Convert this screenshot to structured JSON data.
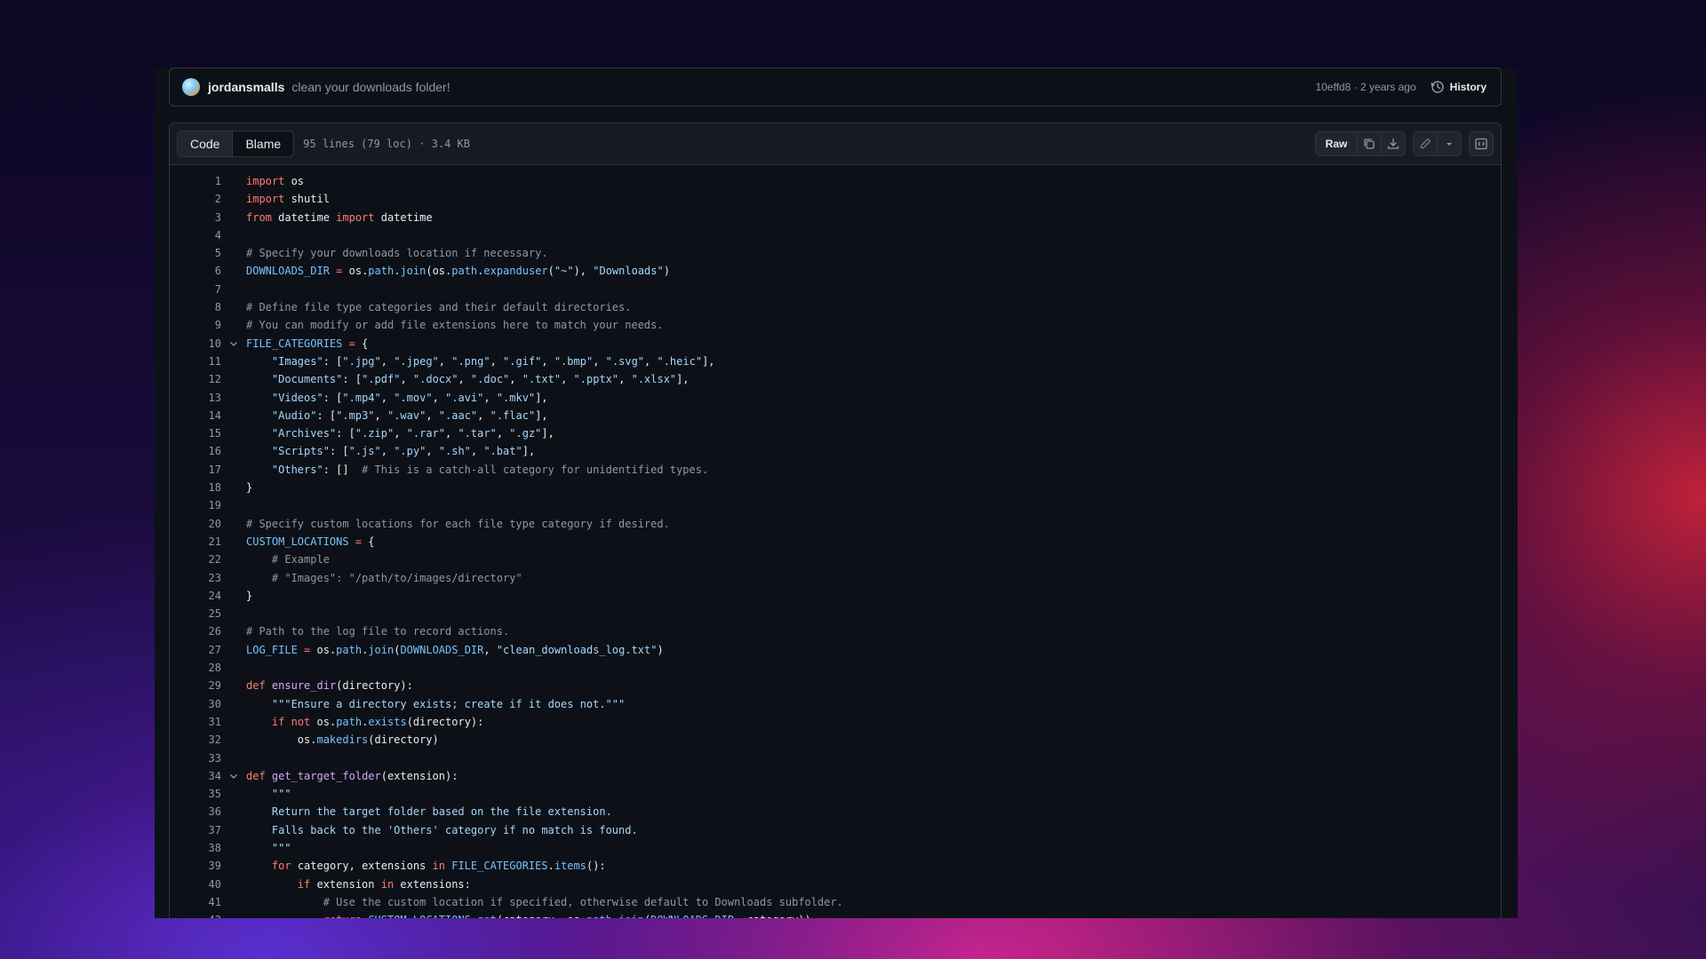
{
  "commit": {
    "author": "jordansmalls",
    "message": "clean your downloads folder!",
    "meta": "10effd8 · 2 years ago",
    "history_label": "History"
  },
  "toolbar": {
    "tabs": [
      "Code",
      "Blame"
    ],
    "active_tab": "Code",
    "file_info": "95 lines (79 loc) · 3.4 KB",
    "raw_label": "Raw",
    "icons": [
      "copy-icon",
      "download-icon",
      "pencil-icon",
      "chevron-down-icon",
      "symbols-icon"
    ]
  },
  "code": {
    "foldable_lines": [
      10,
      34
    ],
    "lines": [
      [
        [
          "k",
          "import"
        ],
        [
          "n",
          " os"
        ]
      ],
      [
        [
          "k",
          "import"
        ],
        [
          "n",
          " shutil"
        ]
      ],
      [
        [
          "k",
          "from"
        ],
        [
          "n",
          " datetime "
        ],
        [
          "k",
          "import"
        ],
        [
          "n",
          " datetime"
        ]
      ],
      [],
      [
        [
          "c",
          "# Specify your downloads location if necessary."
        ]
      ],
      [
        [
          "v",
          "DOWNLOADS_DIR"
        ],
        [
          "n",
          " "
        ],
        [
          "k2",
          "="
        ],
        [
          "n",
          " os."
        ],
        [
          "a",
          "path"
        ],
        [
          "n",
          "."
        ],
        [
          "a",
          "join"
        ],
        [
          "n",
          "(os."
        ],
        [
          "a",
          "path"
        ],
        [
          "n",
          "."
        ],
        [
          "a",
          "expanduser"
        ],
        [
          "n",
          "("
        ],
        [
          "s",
          "\"~\""
        ],
        [
          "n",
          "), "
        ],
        [
          "s",
          "\"Downloads\""
        ],
        [
          "n",
          ")"
        ]
      ],
      [],
      [
        [
          "c",
          "# Define file type categories and their default directories."
        ]
      ],
      [
        [
          "c",
          "# You can modify or add file extensions here to match your needs."
        ]
      ],
      [
        [
          "v",
          "FILE_CATEGORIES"
        ],
        [
          "n",
          " "
        ],
        [
          "k2",
          "="
        ],
        [
          "n",
          " {"
        ]
      ],
      [
        [
          "n",
          "    "
        ],
        [
          "s",
          "\"Images\""
        ],
        [
          "n",
          ": ["
        ],
        [
          "s",
          "\".jpg\""
        ],
        [
          "n",
          ", "
        ],
        [
          "s",
          "\".jpeg\""
        ],
        [
          "n",
          ", "
        ],
        [
          "s",
          "\".png\""
        ],
        [
          "n",
          ", "
        ],
        [
          "s",
          "\".gif\""
        ],
        [
          "n",
          ", "
        ],
        [
          "s",
          "\".bmp\""
        ],
        [
          "n",
          ", "
        ],
        [
          "s",
          "\".svg\""
        ],
        [
          "n",
          ", "
        ],
        [
          "s",
          "\".heic\""
        ],
        [
          "n",
          "],"
        ]
      ],
      [
        [
          "n",
          "    "
        ],
        [
          "s",
          "\"Documents\""
        ],
        [
          "n",
          ": ["
        ],
        [
          "s",
          "\".pdf\""
        ],
        [
          "n",
          ", "
        ],
        [
          "s",
          "\".docx\""
        ],
        [
          "n",
          ", "
        ],
        [
          "s",
          "\".doc\""
        ],
        [
          "n",
          ", "
        ],
        [
          "s",
          "\".txt\""
        ],
        [
          "n",
          ", "
        ],
        [
          "s",
          "\".pptx\""
        ],
        [
          "n",
          ", "
        ],
        [
          "s",
          "\".xlsx\""
        ],
        [
          "n",
          "],"
        ]
      ],
      [
        [
          "n",
          "    "
        ],
        [
          "s",
          "\"Videos\""
        ],
        [
          "n",
          ": ["
        ],
        [
          "s",
          "\".mp4\""
        ],
        [
          "n",
          ", "
        ],
        [
          "s",
          "\".mov\""
        ],
        [
          "n",
          ", "
        ],
        [
          "s",
          "\".avi\""
        ],
        [
          "n",
          ", "
        ],
        [
          "s",
          "\".mkv\""
        ],
        [
          "n",
          "],"
        ]
      ],
      [
        [
          "n",
          "    "
        ],
        [
          "s",
          "\"Audio\""
        ],
        [
          "n",
          ": ["
        ],
        [
          "s",
          "\".mp3\""
        ],
        [
          "n",
          ", "
        ],
        [
          "s",
          "\".wav\""
        ],
        [
          "n",
          ", "
        ],
        [
          "s",
          "\".aac\""
        ],
        [
          "n",
          ", "
        ],
        [
          "s",
          "\".flac\""
        ],
        [
          "n",
          "],"
        ]
      ],
      [
        [
          "n",
          "    "
        ],
        [
          "s",
          "\"Archives\""
        ],
        [
          "n",
          ": ["
        ],
        [
          "s",
          "\".zip\""
        ],
        [
          "n",
          ", "
        ],
        [
          "s",
          "\".rar\""
        ],
        [
          "n",
          ", "
        ],
        [
          "s",
          "\".tar\""
        ],
        [
          "n",
          ", "
        ],
        [
          "s",
          "\".gz\""
        ],
        [
          "n",
          "],"
        ]
      ],
      [
        [
          "n",
          "    "
        ],
        [
          "s",
          "\"Scripts\""
        ],
        [
          "n",
          ": ["
        ],
        [
          "s",
          "\".js\""
        ],
        [
          "n",
          ", "
        ],
        [
          "s",
          "\".py\""
        ],
        [
          "n",
          ", "
        ],
        [
          "s",
          "\".sh\""
        ],
        [
          "n",
          ", "
        ],
        [
          "s",
          "\".bat\""
        ],
        [
          "n",
          "],"
        ]
      ],
      [
        [
          "n",
          "    "
        ],
        [
          "s",
          "\"Others\""
        ],
        [
          "n",
          ": []  "
        ],
        [
          "c",
          "# This is a catch-all category for unidentified types."
        ]
      ],
      [
        [
          "n",
          "}"
        ]
      ],
      [],
      [
        [
          "c",
          "# Specify custom locations for each file type category if desired."
        ]
      ],
      [
        [
          "v",
          "CUSTOM_LOCATIONS"
        ],
        [
          "n",
          " "
        ],
        [
          "k2",
          "="
        ],
        [
          "n",
          " {"
        ]
      ],
      [
        [
          "n",
          "    "
        ],
        [
          "c",
          "# Example"
        ]
      ],
      [
        [
          "n",
          "    "
        ],
        [
          "c",
          "# \"Images\": \"/path/to/images/directory\""
        ]
      ],
      [
        [
          "n",
          "}"
        ]
      ],
      [],
      [
        [
          "c",
          "# Path to the log file to record actions."
        ]
      ],
      [
        [
          "v",
          "LOG_FILE"
        ],
        [
          "n",
          " "
        ],
        [
          "k2",
          "="
        ],
        [
          "n",
          " os."
        ],
        [
          "a",
          "path"
        ],
        [
          "n",
          "."
        ],
        [
          "a",
          "join"
        ],
        [
          "n",
          "("
        ],
        [
          "v",
          "DOWNLOADS_DIR"
        ],
        [
          "n",
          ", "
        ],
        [
          "s",
          "\"clean_downloads_log.txt\""
        ],
        [
          "n",
          ")"
        ]
      ],
      [],
      [
        [
          "k",
          "def"
        ],
        [
          "n",
          " "
        ],
        [
          "f",
          "ensure_dir"
        ],
        [
          "n",
          "(directory):"
        ]
      ],
      [
        [
          "n",
          "    "
        ],
        [
          "s",
          "\"\"\"Ensure a directory exists; create if it does not.\"\"\""
        ]
      ],
      [
        [
          "n",
          "    "
        ],
        [
          "k",
          "if"
        ],
        [
          "n",
          " "
        ],
        [
          "k",
          "not"
        ],
        [
          "n",
          " os."
        ],
        [
          "a",
          "path"
        ],
        [
          "n",
          "."
        ],
        [
          "a",
          "exists"
        ],
        [
          "n",
          "(directory):"
        ]
      ],
      [
        [
          "n",
          "        os."
        ],
        [
          "a",
          "makedirs"
        ],
        [
          "n",
          "(directory)"
        ]
      ],
      [],
      [
        [
          "k",
          "def"
        ],
        [
          "n",
          " "
        ],
        [
          "f",
          "get_target_folder"
        ],
        [
          "n",
          "(extension):"
        ]
      ],
      [
        [
          "n",
          "    "
        ],
        [
          "s",
          "\"\"\""
        ]
      ],
      [
        [
          "s",
          "    Return the target folder based on the file extension."
        ]
      ],
      [
        [
          "s",
          "    Falls back to the 'Others' category if no match is found."
        ]
      ],
      [
        [
          "n",
          "    "
        ],
        [
          "s",
          "\"\"\""
        ]
      ],
      [
        [
          "n",
          "    "
        ],
        [
          "k",
          "for"
        ],
        [
          "n",
          " category, extensions "
        ],
        [
          "k2",
          "in"
        ],
        [
          "n",
          " "
        ],
        [
          "v",
          "FILE_CATEGORIES"
        ],
        [
          "n",
          "."
        ],
        [
          "a",
          "items"
        ],
        [
          "n",
          "():"
        ]
      ],
      [
        [
          "n",
          "        "
        ],
        [
          "k",
          "if"
        ],
        [
          "n",
          " extension "
        ],
        [
          "k2",
          "in"
        ],
        [
          "n",
          " extensions:"
        ]
      ],
      [
        [
          "n",
          "            "
        ],
        [
          "c",
          "# Use the custom location if specified, otherwise default to Downloads subfolder."
        ]
      ],
      [
        [
          "n",
          "            "
        ],
        [
          "k",
          "return"
        ],
        [
          "n",
          " "
        ],
        [
          "v",
          "CUSTOM_LOCATIONS"
        ],
        [
          "n",
          "."
        ],
        [
          "a",
          "get"
        ],
        [
          "n",
          "(category, os."
        ],
        [
          "a",
          "path"
        ],
        [
          "n",
          "."
        ],
        [
          "a",
          "join"
        ],
        [
          "n",
          "("
        ],
        [
          "v",
          "DOWNLOADS_DIR"
        ],
        [
          "n",
          ", category))"
        ]
      ]
    ]
  }
}
